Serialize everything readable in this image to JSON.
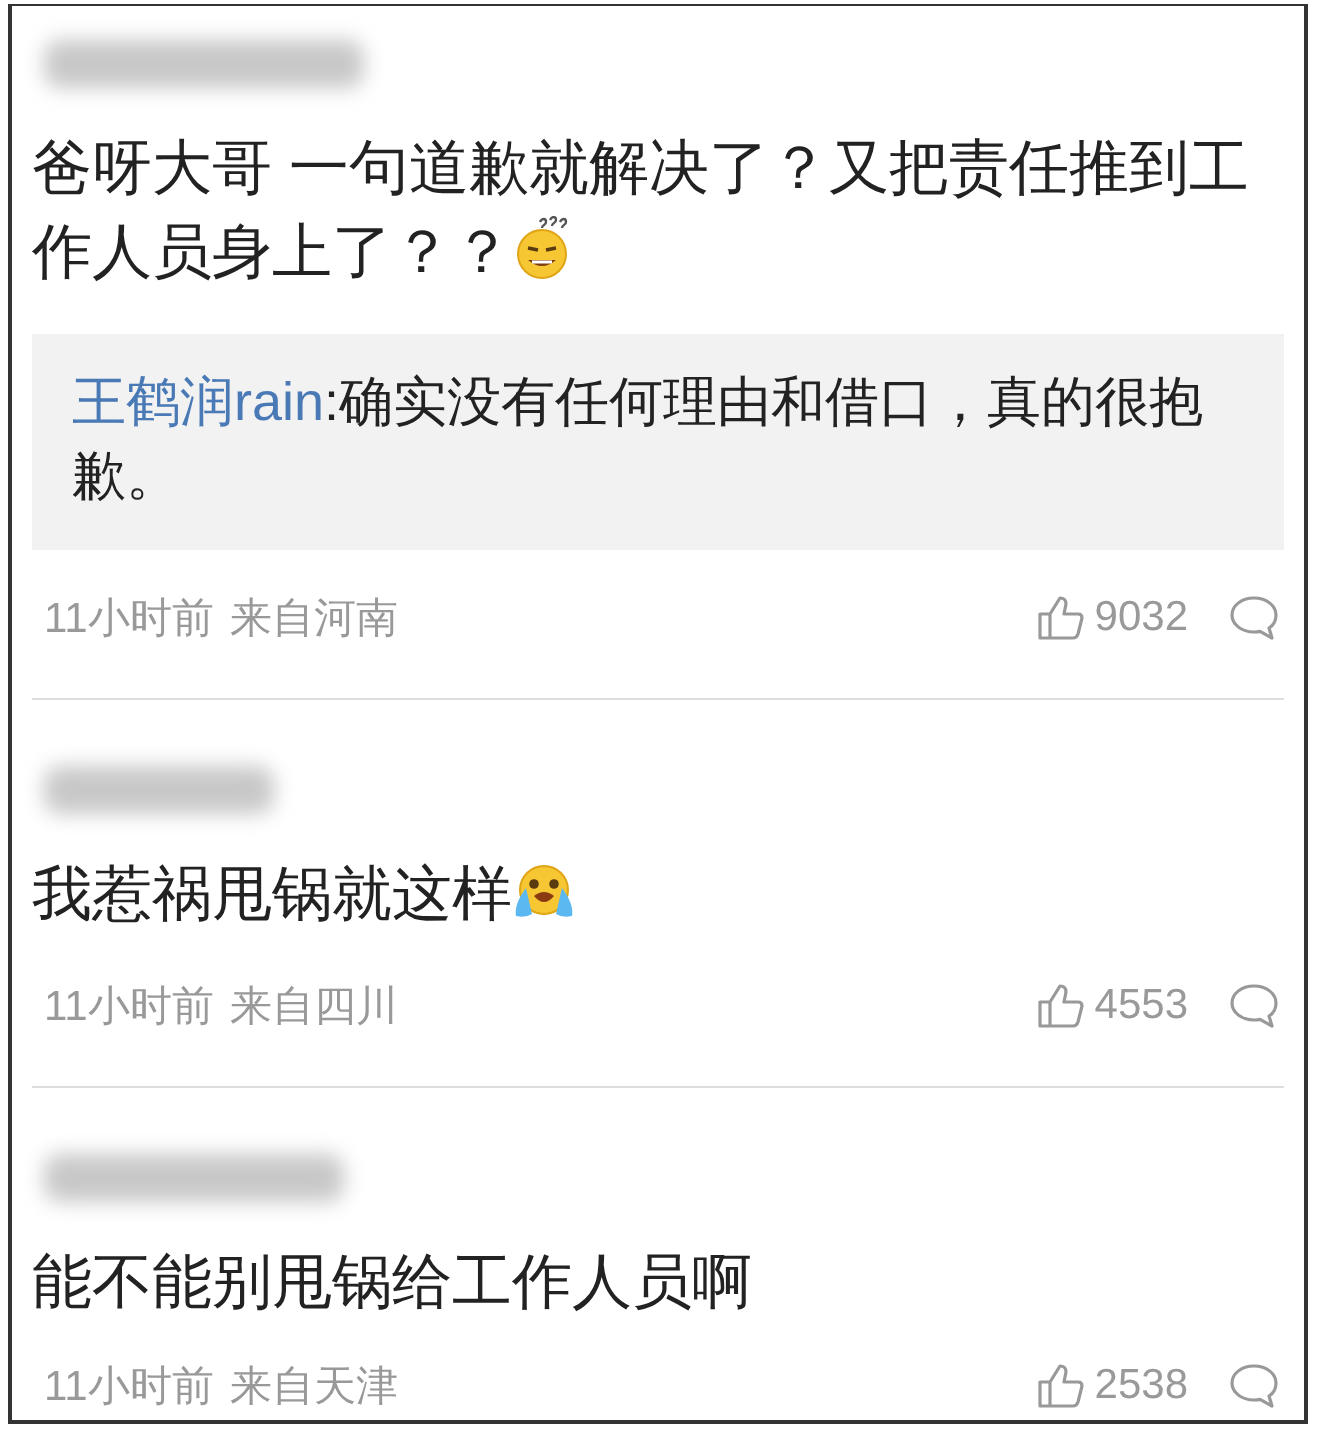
{
  "comments": [
    {
      "text": "爸呀大哥 一句道歉就解决了？又把责任推到工作人员身上了？？",
      "emoji": {
        "kind": "dizzy"
      },
      "reply": {
        "author": "王鹤润rain",
        "text": ":确实没有任何理由和借口，真的很抱歉。"
      },
      "time": "11小时前",
      "source": "来自河南",
      "likes": "9032"
    },
    {
      "text": "我惹祸甩锅就这样",
      "emoji": {
        "kind": "crying"
      },
      "time": "11小时前",
      "source": "来自四川",
      "likes": "4553"
    },
    {
      "text": "能不能别甩锅给工作人员啊",
      "time": "11小时前",
      "source": "来自天津",
      "likes": "2538"
    }
  ]
}
